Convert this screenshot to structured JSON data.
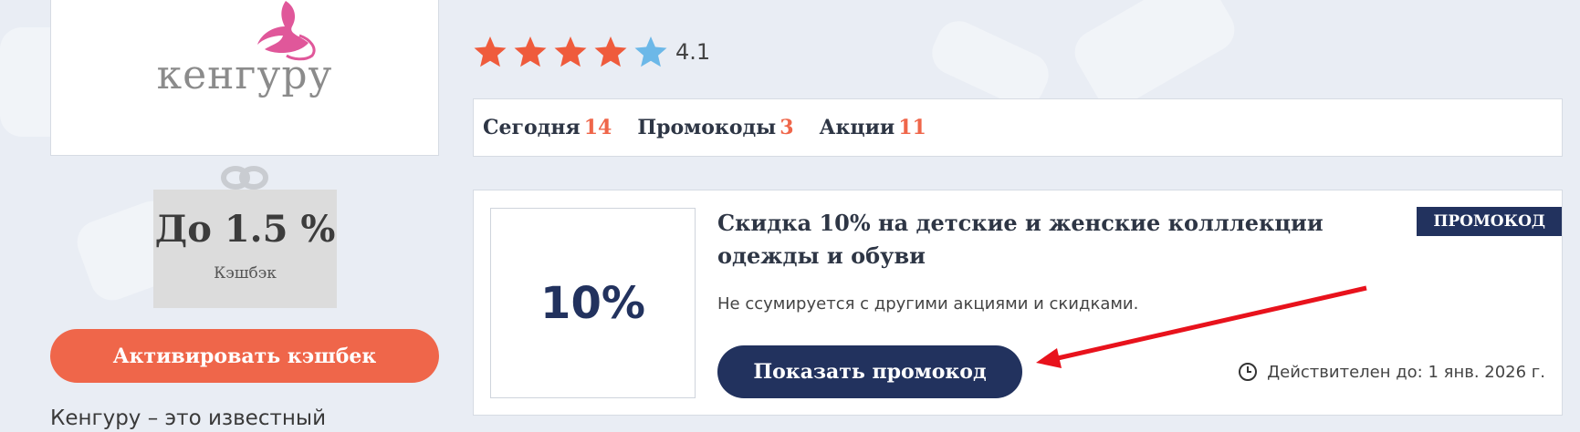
{
  "store": {
    "logo_text": "кенгуру",
    "description": "Кенгуру – это известный"
  },
  "cashback": {
    "value": "До 1.5 %",
    "label": "Кэшбэк",
    "activate_label": "Активировать кэшбек"
  },
  "rating": {
    "value": "4.1",
    "score": 4.1,
    "max": 5,
    "filled_color": "#ef5b3c",
    "empty_color": "#6cb8e8"
  },
  "tabs": [
    {
      "label": "Сегодня",
      "count": "14"
    },
    {
      "label": "Промокоды",
      "count": "3"
    },
    {
      "label": "Акции",
      "count": "11"
    }
  ],
  "promo": {
    "discount": "10%",
    "title": "Скидка 10% на детские и женские колллекции одежды и обуви",
    "badge": "ПРОМОКОД",
    "note": "Не ссумируется с другими акциями и скидками.",
    "button_label": "Показать промокод",
    "validity": "Действителен до: 1 янв. 2026 г."
  },
  "colors": {
    "accent_orange": "#ef664a",
    "navy": "#22325e",
    "annotation_arrow": "#e8121c"
  },
  "icons": {
    "clock": "clock-icon",
    "bow": "gift-bow-icon",
    "logo": "kangaroo-logo"
  }
}
